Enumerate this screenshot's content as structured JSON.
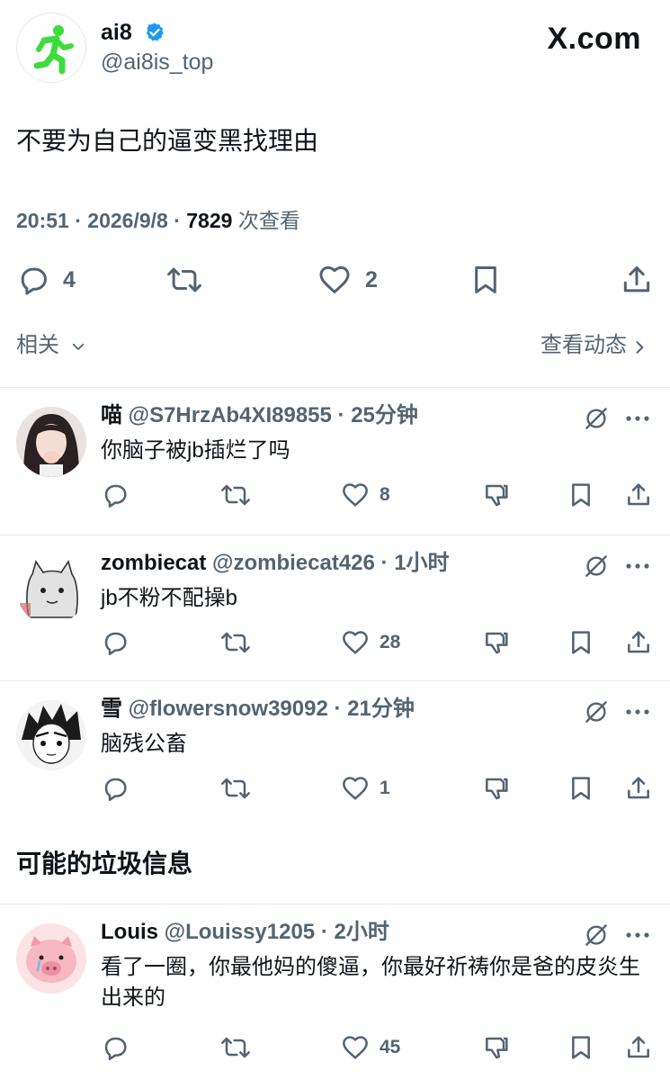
{
  "post": {
    "author_name": "ai8",
    "author_handle": "@ai8is_top",
    "brand": "X.com",
    "text": "不要为自己的逼变黑找理由",
    "time": "20:51",
    "date": "2026/9/8",
    "views_count": "7829",
    "views_label": "次查看",
    "replies_count": "4",
    "likes_count": "2",
    "accent_color": "#1d9bf0",
    "avatar_icon": "running-man-exit-icon",
    "avatar_icon_color": "#3ddc3d"
  },
  "related": {
    "label": "相关",
    "activity_link": "查看动态"
  },
  "replies": [
    {
      "name": "喵",
      "handle": "@S7HrzAb4XI89855",
      "time": "25分钟",
      "text": "你脑子被jb插烂了吗",
      "likes": "8"
    },
    {
      "name": "zombiecat",
      "handle": "@zombiecat426",
      "time": "1小时",
      "text": "jb不粉不配操b",
      "likes": "28"
    },
    {
      "name": "雪",
      "handle": "@flowersnow39092",
      "time": "21分钟",
      "text": "脑残公畜",
      "likes": "1"
    }
  ],
  "spam_section": {
    "title": "可能的垃圾信息",
    "replies": [
      {
        "name": "Louis",
        "handle": "@Louissy1205",
        "time": "2小时",
        "text": "看了一圈，你最他妈的傻逼，你最好祈祷你是爸的皮炎生出来的",
        "likes": "45"
      }
    ]
  },
  "separator": " · "
}
